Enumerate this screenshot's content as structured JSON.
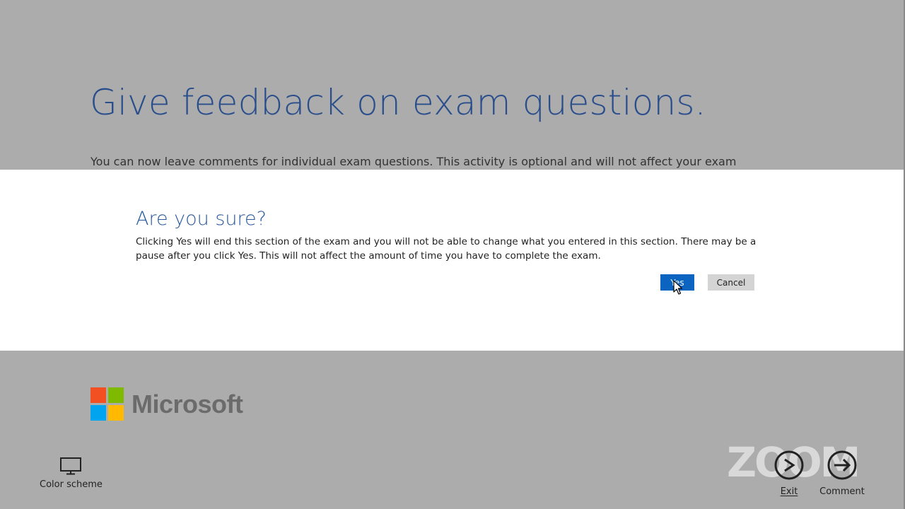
{
  "page": {
    "title": "Give feedback on exam questions.",
    "intro": "You can now leave comments for individual exam questions. This activity is optional and will not affect your exam"
  },
  "dialog": {
    "title": "Are you sure?",
    "message": "Clicking Yes will end this section of the exam and you will not be able to change what you entered in this section. There may be a pause after you click Yes. This will not affect the amount of time you have to complete the exam.",
    "yes_label": "Yes",
    "cancel_label": "Cancel"
  },
  "brand": {
    "name": "Microsoft",
    "logo_colors": [
      "#f25022",
      "#7fba00",
      "#00a4ef",
      "#ffb900"
    ]
  },
  "footer": {
    "color_scheme_label": "Color scheme",
    "color_scheme_icon": "monitor-icon",
    "exit_label": "Exit",
    "exit_icon": "exit-icon",
    "comment_label": "Comment",
    "comment_icon": "arrow-right-circle-icon"
  },
  "overlay": {
    "watermark": "ZOOM"
  },
  "colors": {
    "backdrop": "#acacac",
    "title": "#2a4e8c",
    "primary_button": "#0a64c0",
    "secondary_button": "#d4d4d4"
  }
}
